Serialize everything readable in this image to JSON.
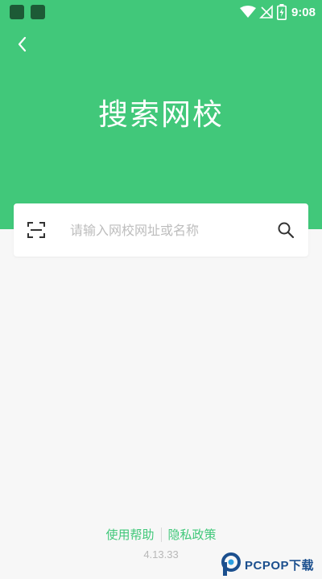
{
  "status_bar": {
    "time": "9:08",
    "icons": [
      "notification-icon",
      "notification-icon",
      "wifi-icon",
      "no-signal-icon",
      "battery-charging-icon"
    ]
  },
  "header": {
    "back_icon": "chevron-left-icon",
    "title": "搜索网校"
  },
  "search": {
    "scan_icon": "scan-icon",
    "placeholder": "请输入网校网址或名称",
    "value": "",
    "search_icon": "search-icon"
  },
  "footer": {
    "help_label": "使用帮助",
    "privacy_label": "隐私政策",
    "version": "4.13.33"
  },
  "watermark": {
    "text": "PCPOP下载"
  },
  "colors": {
    "accent": "#41c87a",
    "background": "#f7f7f7",
    "card": "#ffffff",
    "placeholder": "#bdbdbd",
    "version": "#b8b8b8"
  }
}
